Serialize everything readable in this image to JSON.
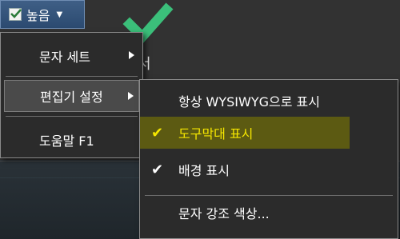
{
  "toolbar": {
    "dropdown_label": "높음",
    "dropdown_caret": "▼"
  },
  "background": {
    "partial_text": "서"
  },
  "main_menu": {
    "items": [
      {
        "label": "문자 세트",
        "has_submenu": true
      },
      {
        "label": "편집기 설정",
        "has_submenu": true,
        "highlighted": true
      },
      {
        "label": "도움말 F1",
        "has_submenu": false
      }
    ]
  },
  "submenu": {
    "items": [
      {
        "label": "항상 WYSIWYG으로 표시",
        "checked": false
      },
      {
        "label": "도구막대 표시",
        "checked": true,
        "highlighted": true
      },
      {
        "label": "배경 표시",
        "checked": true
      },
      {
        "label": "문자 강조 색상...",
        "checked": false
      }
    ],
    "check_glyph": "✔"
  },
  "colors": {
    "highlight_submenu_row": "#5c5a12",
    "highlight_text": "#f5e600",
    "check_color": "#ffffff"
  }
}
